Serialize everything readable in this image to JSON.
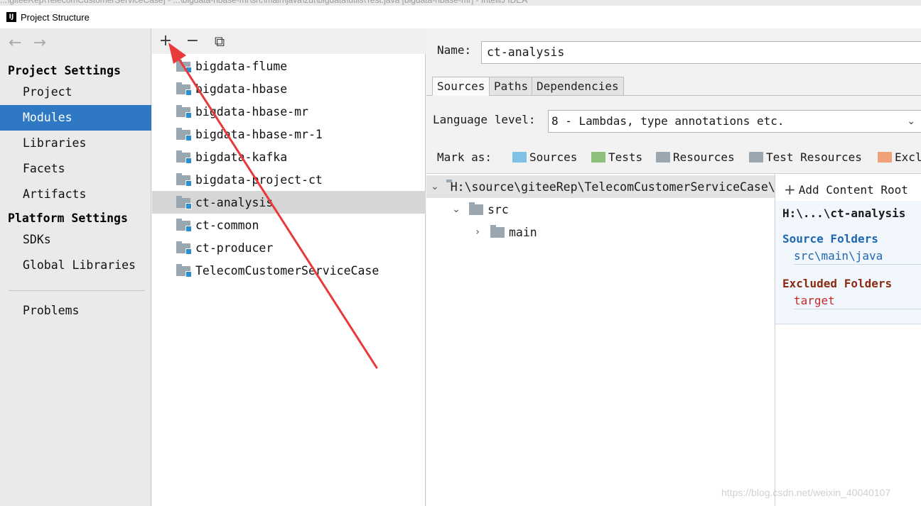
{
  "window": {
    "background_title": "...\\giteeRep\\TelecomCustomerServiceCase] - ...\\bigdata-hbase-mr\\src\\main\\java\\zut\\bigdata\\utils\\Test.java [bigdata-hbase-mr] - IntelliJ IDEA",
    "title": "Project Structure",
    "app_icon_text": "IJ"
  },
  "nav": {
    "back_icon": "←",
    "forward_icon": "→",
    "project_settings_heading": "Project Settings",
    "project_settings_items": [
      "Project",
      "Modules",
      "Libraries",
      "Facets",
      "Artifacts"
    ],
    "selected_item": "Modules",
    "platform_settings_heading": "Platform Settings",
    "platform_settings_items": [
      "SDKs",
      "Global Libraries"
    ],
    "problems_label": "Problems"
  },
  "modules": {
    "toolbar": {
      "add": "+",
      "remove": "−",
      "copy": "⧉"
    },
    "items": [
      "bigdata-flume",
      "bigdata-hbase",
      "bigdata-hbase-mr",
      "bigdata-hbase-mr-1",
      "bigdata-kafka",
      "bigdata-project-ct",
      "ct-analysis",
      "ct-common",
      "ct-producer",
      "TelecomCustomerServiceCase"
    ],
    "selected": "ct-analysis"
  },
  "detail": {
    "name_label": "Name:",
    "name_value": "ct-analysis",
    "tabs": [
      "Sources",
      "Paths",
      "Dependencies"
    ],
    "active_tab": "Sources",
    "language_level_label": "Language level:",
    "language_level_value": "8 - Lambdas, type annotations etc.",
    "mark_as_label": "Mark as:",
    "mark_as_buttons": [
      {
        "label": "Sources",
        "color": "#7fc0e6"
      },
      {
        "label": "Tests",
        "color": "#8ec07c"
      },
      {
        "label": "Resources",
        "color": "#9aa7b0"
      },
      {
        "label": "Test Resources",
        "color": "#9aa7b0"
      },
      {
        "label": "Excl",
        "color": "#f0a276"
      }
    ],
    "tree": {
      "root": "H:\\source\\giteeRep\\TelecomCustomerServiceCase\\ct-analysis",
      "src": "src",
      "main": "main"
    },
    "content_root": {
      "add_label": "Add Content Root",
      "root_path": "H:\\...\\ct-analysis",
      "source_folders_heading": "Source Folders",
      "source_folder": "src\\main\\java",
      "excluded_folders_heading": "Excluded Folders",
      "excluded_folder": "target"
    }
  },
  "watermark": "https://blog.csdn.net/weixin_40040107",
  "colors": {
    "selection_blue": "#2f79c4",
    "annotation_arrow": "#e8393b",
    "source_folder_blue": "#1f66b0",
    "excluded_red": "#c42a2a"
  }
}
